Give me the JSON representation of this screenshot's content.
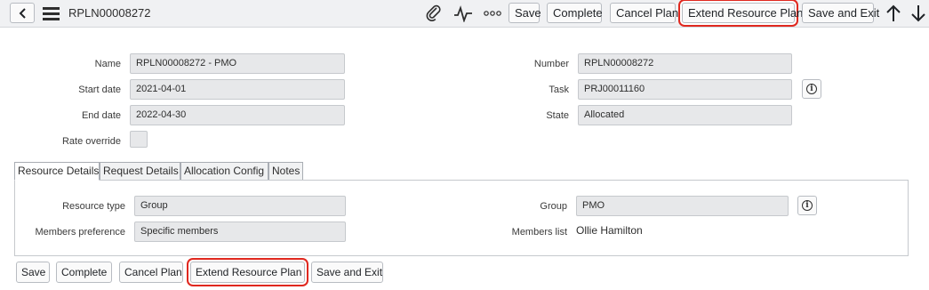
{
  "header": {
    "back_icon": "chevron-left-icon",
    "menu_icon": "hamburger-menu-icon",
    "record_title": "RPLN00008272",
    "attach_icon": "paperclip-icon",
    "activity_icon": "activity-pulse-icon",
    "more_icon": "more-options-icon",
    "save_label": "Save",
    "complete_label": "Complete",
    "cancel_plan_label": "Cancel Plan",
    "extend_label": "Extend Resource Plan",
    "save_exit_label": "Save and Exit",
    "prev_icon": "arrow-up-icon",
    "next_icon": "arrow-down-icon",
    "highlight_color": "#e0281f"
  },
  "form": {
    "name_label": "Name",
    "name_value": "RPLN00008272 - PMO",
    "start_label": "Start date",
    "start_value": "2021-04-01",
    "end_label": "End date",
    "end_value": "2022-04-30",
    "rate_label": "Rate override",
    "number_label": "Number",
    "number_value": "RPLN00008272",
    "task_label": "Task",
    "task_value": "PRJ00011160",
    "state_label": "State",
    "state_value": "Allocated"
  },
  "tabs": [
    {
      "label": "Resource Details"
    },
    {
      "label": "Request Details"
    },
    {
      "label": "Allocation Config"
    },
    {
      "label": "Notes"
    }
  ],
  "resource_details": {
    "resource_type_label": "Resource type",
    "resource_type_value": "Group",
    "members_pref_label": "Members preference",
    "members_pref_value": "Specific members",
    "group_label": "Group",
    "group_value": "PMO",
    "members_list_label": "Members list",
    "members_list_value": "Ollie Hamilton"
  },
  "footer": {
    "save_label": "Save",
    "complete_label": "Complete",
    "cancel_plan_label": "Cancel Plan",
    "extend_label": "Extend Resource Plan",
    "save_exit_label": "Save and Exit"
  }
}
